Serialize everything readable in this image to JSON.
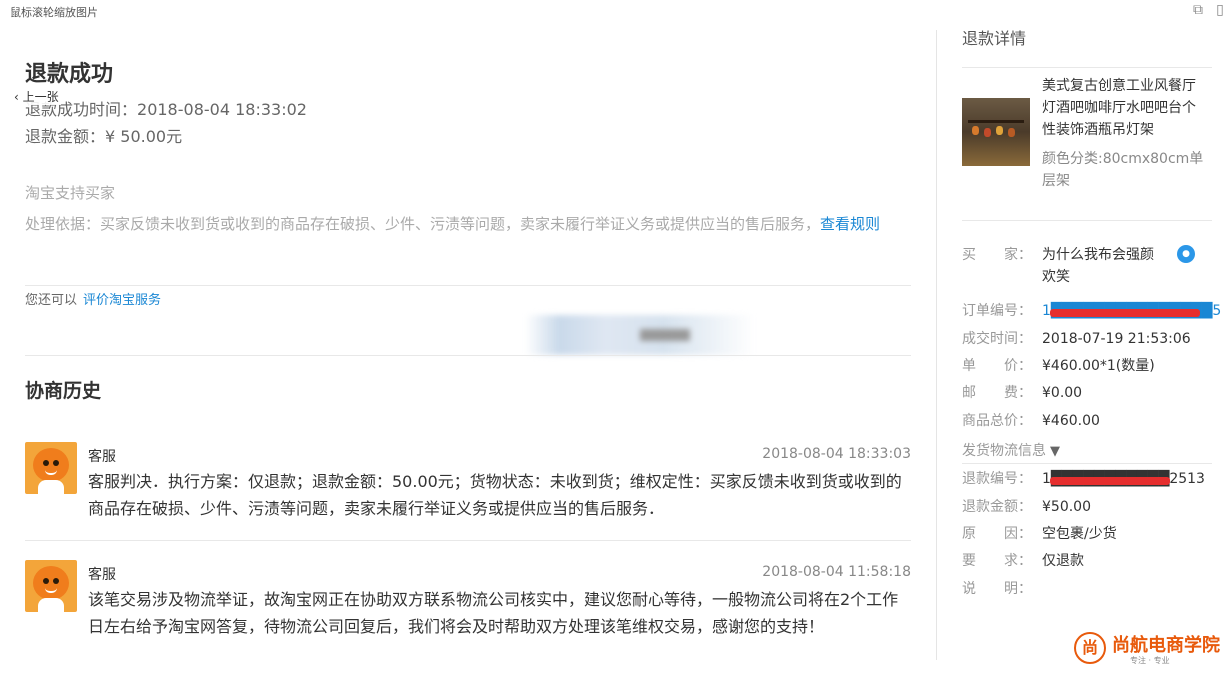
{
  "viewer": {
    "title": "鼠标滚轮缩放图片",
    "prev_label": "上一张",
    "open_icon": "external-link-icon",
    "close_icon": "window-icon"
  },
  "refund": {
    "title": "退款成功",
    "success_time_label": "退款成功时间：",
    "success_time": "2018-08-04 18:33:02",
    "amount_label": "退款金额：",
    "amount": "¥ 50.00元",
    "support_title": "淘宝支持买家",
    "basis_text": "处理依据：买家反馈未收到货或收到的商品存在破损、少件、污渍等问题，卖家未履行举证义务或提供应当的售后服务，",
    "rules_link": "查看规则",
    "also_label": "您还可以",
    "rate_link": "评价淘宝服务"
  },
  "history": {
    "title": "协商历史",
    "messages": [
      {
        "sender": "客服",
        "time": "2018-08-04 18:33:03",
        "text": "客服判决．执行方案：仅退款；退款金额：50.00元；货物状态：未收到货；维权定性：买家反馈未收到货或收到的商品存在破损、少件、污渍等问题，卖家未履行举证义务或提供应当的售后服务．"
      },
      {
        "sender": "客服",
        "time": "2018-08-04 11:58:18",
        "text": "该笔交易涉及物流举证，故淘宝网正在协助双方联系物流公司核实中，建议您耐心等待，一般物流公司将在2个工作日左右给予淘宝网答复，待物流公司回复后，我们将会及时帮助双方处理该笔维权交易，感谢您的支持！"
      }
    ]
  },
  "side": {
    "title": "退款详情",
    "product_name": "美式复古创意工业风餐厅灯酒吧咖啡厅水吧吧台个性装饰酒瓶吊灯架",
    "product_spec": "颜色分类:80cmx80cm单层架",
    "buyer_label": "买　　家：",
    "buyer_value": "为什么我布会强颜欢笑",
    "order_label": "订单编号：",
    "order_value": "1███████████████5",
    "deal_time_label": "成交时间：",
    "deal_time_value": "2018-07-19 21:53:06",
    "price_label": "单　　价：",
    "price_value": "¥460.00*1(数量)",
    "shipping_label": "邮　　费：",
    "shipping_value": "¥0.00",
    "total_label": "商品总价：",
    "total_value": "¥460.00",
    "logistics_label": "发货物流信息",
    "refund_no_label": "退款编号：",
    "refund_no_value": "1███████████2513",
    "refund_amount_label": "退款金额：",
    "refund_amount_value": "¥50.00",
    "reason_label": "原　　因：",
    "reason_value": "空包裹/少货",
    "request_label": "要　　求：",
    "request_value": "仅退款",
    "note_label": "说　　明：",
    "note_value": ""
  },
  "watermark": {
    "name": "尚航电商学院",
    "tag": "专注 · 专业"
  }
}
